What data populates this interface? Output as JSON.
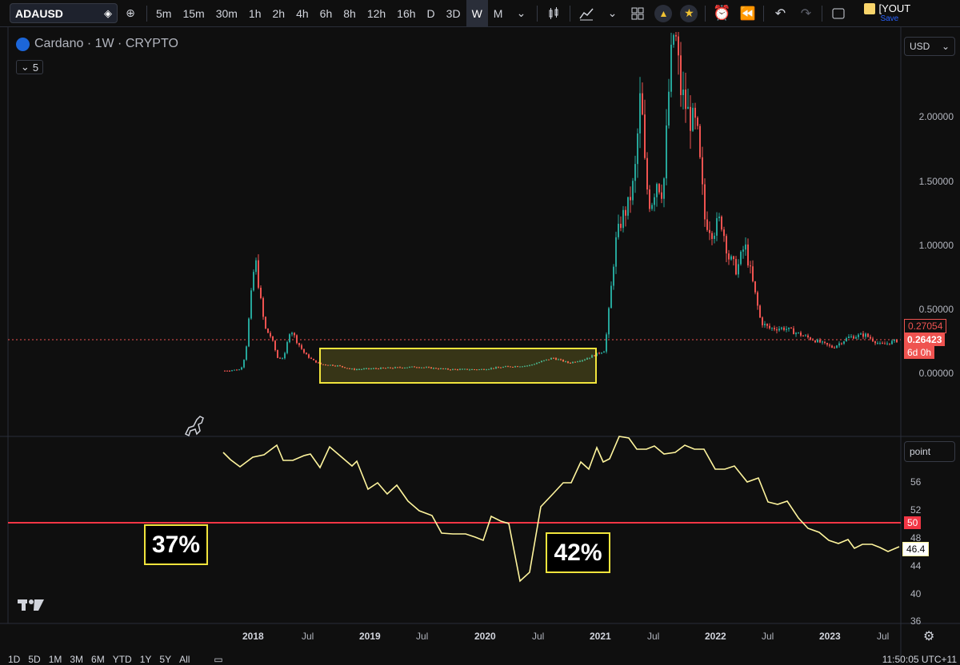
{
  "toolbar": {
    "symbol": "ADAUSD",
    "intervals": [
      "5m",
      "15m",
      "30m",
      "1h",
      "2h",
      "4h",
      "6h",
      "8h",
      "12h",
      "16h",
      "D",
      "3D",
      "W",
      "M"
    ],
    "active_interval": "W",
    "save_label": "Save",
    "layout_name": "[YOUT"
  },
  "legend": {
    "title": "Cardano · 1W · CRYPTO",
    "collapse_count": "5"
  },
  "price_axis": {
    "currency": "USD",
    "labels": [
      "2.00000",
      "1.50000",
      "1.00000",
      "0.50000",
      "0.00000"
    ],
    "current_price_1": "0.27054",
    "current_price_2": "0.26423",
    "countdown": "6d 0h"
  },
  "indicator_axis": {
    "unit": "point",
    "labels": [
      "56",
      "52",
      "48",
      "44",
      "40",
      "36"
    ],
    "level_label": "50",
    "current_value": "46.4"
  },
  "annotations": {
    "left_pct": "37%",
    "right_pct": "42%"
  },
  "time_axis": [
    {
      "label": "2018",
      "bold": true
    },
    {
      "label": "Jul",
      "bold": false
    },
    {
      "label": "2019",
      "bold": true
    },
    {
      "label": "Jul",
      "bold": false
    },
    {
      "label": "2020",
      "bold": true
    },
    {
      "label": "Jul",
      "bold": false
    },
    {
      "label": "2021",
      "bold": true
    },
    {
      "label": "Jul",
      "bold": false
    },
    {
      "label": "2022",
      "bold": true
    },
    {
      "label": "Jul",
      "bold": false
    },
    {
      "label": "2023",
      "bold": true
    },
    {
      "label": "Jul",
      "bold": false
    }
  ],
  "bottom_bar": {
    "ranges": [
      "1D",
      "5D",
      "1M",
      "3M",
      "6M",
      "YTD",
      "1Y",
      "5Y",
      "All"
    ],
    "clock": "11:50:05 UTC+11"
  },
  "colors": {
    "up": "#26a69a",
    "down": "#ef5350",
    "highlight": "#f1e43c",
    "level": "#f23645",
    "line": "#fff59d"
  }
}
